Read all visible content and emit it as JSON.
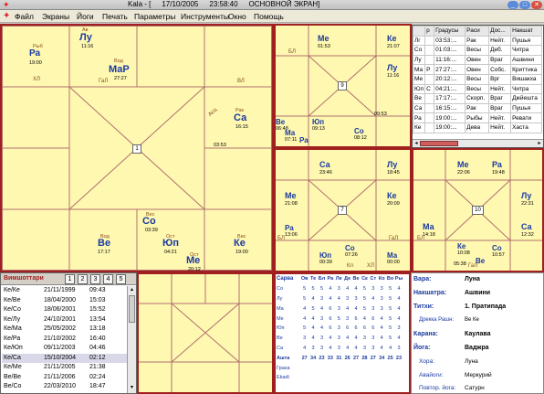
{
  "titlebar": {
    "app": "Kala - [",
    "date": "17/10/2005",
    "time": "23:58:40",
    "screen": "ОСНОВНОЙ ЭКРАН]"
  },
  "menu": [
    "Файл",
    "Экраны",
    "Йоги",
    "Печать",
    "Параметры",
    "Инструменты",
    "Окно",
    "Помощь"
  ],
  "chart1": {
    "house": "1",
    "planets": [
      {
        "id": "ra",
        "name": "Ра",
        "time": "19:00",
        "lab": "Рыб"
      },
      {
        "id": "lu",
        "name": "Лу",
        "time": "11:16",
        "lab": "Ав"
      },
      {
        "id": "mar",
        "name": "МаР",
        "time": "27:27",
        "lab": "Вод"
      },
      {
        "id": "sa",
        "name": "Са",
        "time": "16:15",
        "lab": "Рак"
      },
      {
        "id": "so",
        "name": "Со",
        "time": "03:39",
        "lab": "Вес"
      },
      {
        "id": "ve",
        "name": "Ве",
        "time": "17:17",
        "lab": "Вод"
      },
      {
        "id": "yu",
        "name": "Юп",
        "time": "04:21",
        "lab": "Ост"
      },
      {
        "id": "me",
        "name": "Ме",
        "time": "20:12",
        "lab": "Ост"
      },
      {
        "id": "ke",
        "name": "Ке",
        "time": "19:00",
        "lab": "Вис"
      }
    ],
    "labels": {
      "hl": "ХЛ",
      "gal": "ГаЛ",
      "vl": "ВЛ",
      "asc_time": "03:53",
      "diag": "Асц"
    }
  },
  "chart9": {
    "house": "9",
    "planets": [
      {
        "id": "me",
        "name": "Ме",
        "time": "01:53"
      },
      {
        "id": "ke",
        "name": "Ке",
        "time": "21:07"
      },
      {
        "id": "lu",
        "name": "Лу",
        "time": "11:16"
      },
      {
        "id": "ve",
        "name": "Ве",
        "time": "06:48"
      },
      {
        "id": "ma",
        "name": "Ма",
        "time": "07:11"
      },
      {
        "id": "yu",
        "name": "Юп",
        "time": "09:13"
      },
      {
        "id": "ra",
        "name": "Ра",
        "time": ""
      },
      {
        "id": "so",
        "name": "Со",
        "time": "08:12"
      }
    ],
    "labels": {
      "bl": "БЛ",
      "asc_time": "09:53"
    }
  },
  "chart7": {
    "house": "7",
    "planets": [
      {
        "id": "sa",
        "name": "Са",
        "time": "23:46"
      },
      {
        "id": "lu",
        "name": "Лу",
        "time": "18:45"
      },
      {
        "id": "me",
        "name": "Ме",
        "time": "21:08"
      },
      {
        "id": "ke",
        "name": "Ке",
        "time": "20:09"
      },
      {
        "id": "ra",
        "name": "Ра",
        "time": "13:06"
      },
      {
        "id": "yu",
        "name": "Юп",
        "time": "00:39"
      },
      {
        "id": "so",
        "name": "Со",
        "time": "07:26"
      },
      {
        "id": "ma",
        "name": "Ма",
        "time": "00:00"
      }
    ],
    "labels": {
      "hl": "ХЛ",
      "gal": "ГаЛ",
      "kl": "Кл",
      "bl": "БЛ"
    }
  },
  "chart10": {
    "house": "10",
    "planets": [
      {
        "id": "me",
        "name": "Ме",
        "time": "22:06"
      },
      {
        "id": "ra",
        "name": "Ра",
        "time": "19:48"
      },
      {
        "id": "lu",
        "name": "Лу",
        "time": "22:31"
      },
      {
        "id": "ma",
        "name": "Ма",
        "time": "14:18"
      },
      {
        "id": "sa",
        "name": "Са",
        "time": "12:32"
      },
      {
        "id": "ke",
        "name": "Ке",
        "time": "10:08"
      },
      {
        "id": "ve",
        "name": "Ве",
        "time": "05:38"
      },
      {
        "id": "co",
        "name": "Со",
        "time": "10:57"
      }
    ],
    "labels": {
      "bl": "БЛ",
      "gal": "ГаЛ"
    }
  },
  "planet_table": {
    "headers": [
      "р",
      "Градусы",
      "Раси",
      "Дос...",
      "Накшат"
    ],
    "rows": [
      [
        "Лг",
        "",
        "03:53:...",
        "Рак",
        "Нейт.",
        "Пушья"
      ],
      [
        "Со",
        "",
        "01:03:...",
        "Весы",
        "Деб.",
        "Читра"
      ],
      [
        "Лу",
        "",
        "11:16:...",
        "Овен",
        "Враг",
        "Ашвини"
      ],
      [
        "Ма",
        "Р",
        "27:27:...",
        "Овен",
        "Собс.",
        "Криттика"
      ],
      [
        "Ме",
        "",
        "20:12:...",
        "Весы",
        "Врг",
        "Вишакха"
      ],
      [
        "Юп",
        "С",
        "04:21:...",
        "Весы",
        "Нейт.",
        "Читра"
      ],
      [
        "Ве",
        "",
        "17:17:...",
        "Скорп.",
        "Враг",
        "Джйешта"
      ],
      [
        "Са",
        "",
        "16:15:...",
        "Рак",
        "Враг",
        "Пушья"
      ],
      [
        "Ра",
        "",
        "19:00:...",
        "Рыбы",
        "Нейт.",
        "Ревати"
      ],
      [
        "Ке",
        "",
        "19:00:...",
        "Дева",
        "Нейт.",
        "Хаста"
      ]
    ]
  },
  "vimshottari": {
    "title": "Вимшоттари",
    "tabs": [
      "1",
      "2",
      "3",
      "4",
      "5"
    ],
    "rows": [
      [
        "Ке/Ке",
        "21/11/1999",
        "09:43"
      ],
      [
        "Ке/Ве",
        "18/04/2000",
        "15:03"
      ],
      [
        "Ке/Со",
        "18/06/2001",
        "15:52"
      ],
      [
        "Ке/Лу",
        "24/10/2001",
        "13:54"
      ],
      [
        "Ке/Ма",
        "25/05/2002",
        "13:18"
      ],
      [
        "Ке/Ра",
        "21/10/2002",
        "16:40"
      ],
      [
        "Ке/Юп",
        "09/11/2003",
        "04:46"
      ],
      [
        "Ке/Са",
        "15/10/2004",
        "02:12"
      ],
      [
        "Ке/Ме",
        "21/11/2005",
        "21:38"
      ],
      [
        "Ве/Ве",
        "21/11/2006",
        "02:24"
      ],
      [
        "Ве/Со",
        "22/03/2010",
        "18:47"
      ],
      [
        "Ве/Лу",
        "22/03/2011",
        "19:49"
      ]
    ],
    "selected_index": 7
  },
  "strength": {
    "header_label": "Сарва",
    "cols": [
      "Ов",
      "Те",
      "Бл",
      "Ра",
      "Ле",
      "Де",
      "Ве",
      "Ск",
      "Ст",
      "Ко",
      "Во",
      "Ры"
    ],
    "rows": [
      {
        "label": "Со",
        "vals": [
          "5",
          "5",
          "5",
          "4",
          "3",
          "4",
          "4",
          "5",
          "3",
          "3",
          "5",
          "4"
        ]
      },
      {
        "label": "Лу",
        "vals": [
          "5",
          "4",
          "3",
          "4",
          "4",
          "3",
          "3",
          "5",
          "4",
          "3",
          "5",
          "4"
        ]
      },
      {
        "label": "Ма",
        "vals": [
          "4",
          "5",
          "4",
          "6",
          "3",
          "4",
          "4",
          "5",
          "3",
          "3",
          "5",
          "4"
        ]
      },
      {
        "label": "Ме",
        "vals": [
          "4",
          "4",
          "3",
          "6",
          "5",
          "3",
          "6",
          "4",
          "6",
          "4",
          "5",
          "4"
        ]
      },
      {
        "label": "Юп",
        "vals": [
          "5",
          "4",
          "4",
          "6",
          "3",
          "6",
          "6",
          "6",
          "6",
          "4",
          "5",
          "3"
        ]
      },
      {
        "label": "Ве",
        "vals": [
          "3",
          "4",
          "3",
          "4",
          "3",
          "4",
          "4",
          "3",
          "3",
          "4",
          "5",
          "4"
        ]
      },
      {
        "label": "Са",
        "vals": [
          "4",
          "3",
          "3",
          "4",
          "3",
          "4",
          "4",
          "3",
          "3",
          "4",
          "4",
          "3"
        ]
      },
      {
        "label": "Ашта",
        "vals": [
          "27",
          "34",
          "23",
          "33",
          "31",
          "26",
          "27",
          "28",
          "27",
          "34",
          "25",
          "23"
        ]
      },
      {
        "label": "Граха",
        "vals": [
          "",
          "",
          "",
          "",
          "",
          "",
          "",
          "",
          "",
          "",
          "",
          ""
        ]
      },
      {
        "label": "Ekadi",
        "vals": [
          "",
          "",
          "",
          "",
          "",
          "",
          "",
          "",
          "",
          "",
          "",
          ""
        ]
      }
    ]
  },
  "info": [
    {
      "k": "Вара:",
      "v": "Луна"
    },
    {
      "k": "Накшатра:",
      "v": "Ашвини"
    },
    {
      "k": "Титхи:",
      "v": "1. Пратипада"
    },
    {
      "k": "Дрекка Рашн:",
      "v": "Ве Ке"
    },
    {
      "k": "Карана:",
      "v": "Каулава"
    },
    {
      "k": "Йога:",
      "v": "Ваджра"
    },
    {
      "k": "Хора:",
      "v": "Луна"
    },
    {
      "k": "Авайоги:",
      "v": "Меркурий"
    },
    {
      "k": "Повтор. йога:",
      "v": "Сатурн"
    }
  ],
  "colors": {
    "pane_bg": "#fff8b0",
    "frame": "#a02020",
    "planet": "#1a3aa0",
    "label": "#8a4a20"
  }
}
